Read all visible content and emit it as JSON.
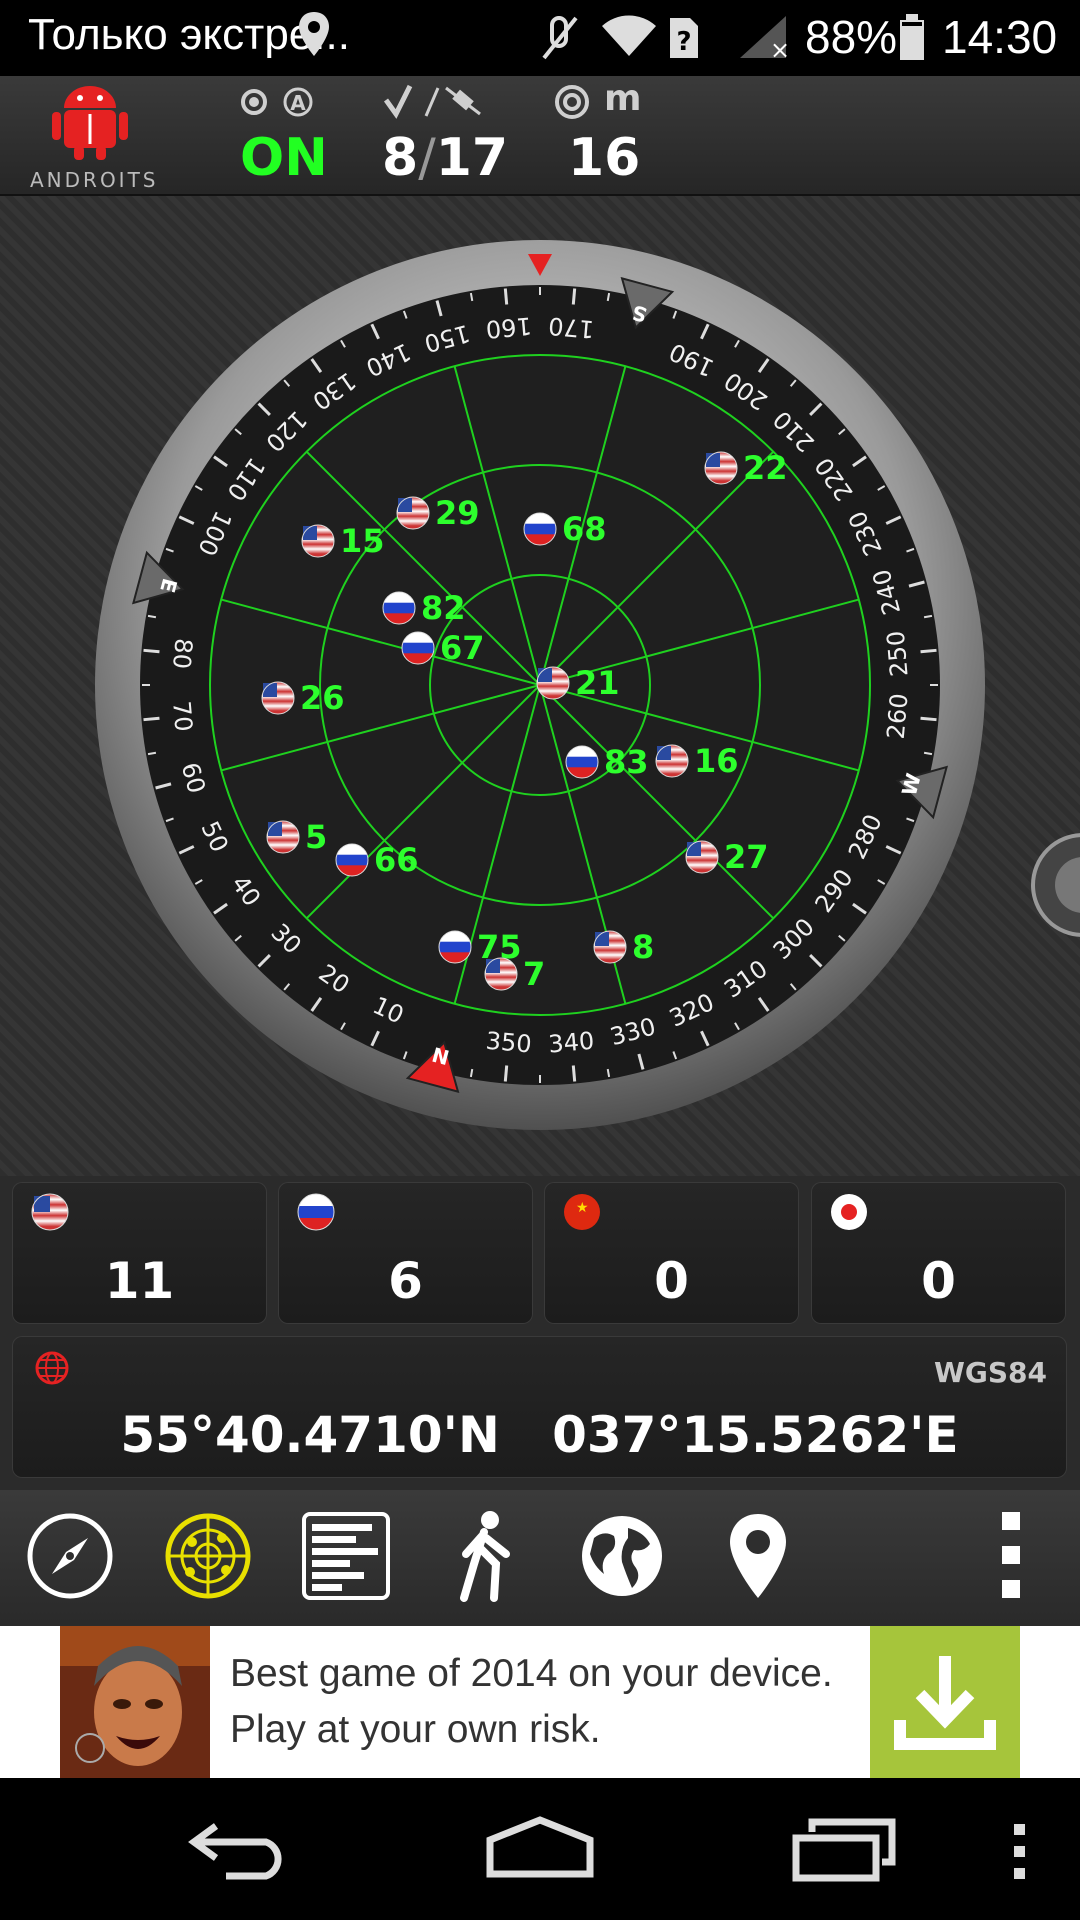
{
  "status_bar": {
    "notification_title": "Только экстре...",
    "battery": "88%",
    "time": "14:30",
    "icons": [
      "location-pin-icon",
      "mute-icon",
      "wifi-icon",
      "sim-unknown-icon",
      "signal-no-sim-icon",
      "battery-icon"
    ]
  },
  "header": {
    "logo_text": "ANDROITS",
    "gps_status": "ON",
    "sats_used": "8",
    "sats_separator": "/",
    "sats_total": "17",
    "accuracy_unit": "m",
    "accuracy_value": "16",
    "colors": {
      "on": "#22ff22",
      "brand": "#e52222"
    }
  },
  "compass": {
    "ticks": [
      "140",
      "150",
      "160",
      "170",
      "190",
      "200",
      "210",
      "220",
      "230",
      "240",
      "250",
      "260",
      "280",
      "290",
      "300",
      "310",
      "320",
      "330",
      "340",
      "350",
      "10",
      "20",
      "30",
      "40",
      "50",
      "60",
      "70",
      "80",
      "100",
      "110",
      "120",
      "130"
    ],
    "cardinals": [
      "N",
      "S",
      "E",
      "W"
    ],
    "satellites": [
      {
        "id": "68",
        "type": "glonass"
      },
      {
        "id": "22",
        "type": "gps"
      },
      {
        "id": "29",
        "type": "gps"
      },
      {
        "id": "15",
        "type": "gps"
      },
      {
        "id": "82",
        "type": "glonass"
      },
      {
        "id": "67",
        "type": "glonass"
      },
      {
        "id": "21",
        "type": "gps"
      },
      {
        "id": "26",
        "type": "gps"
      },
      {
        "id": "83",
        "type": "glonass"
      },
      {
        "id": "16",
        "type": "gps"
      },
      {
        "id": "5",
        "type": "gps"
      },
      {
        "id": "66",
        "type": "glonass"
      },
      {
        "id": "27",
        "type": "gps"
      },
      {
        "id": "75",
        "type": "glonass"
      },
      {
        "id": "7",
        "type": "gps"
      },
      {
        "id": "8",
        "type": "gps"
      }
    ],
    "colors": {
      "grid": "#1fd11f",
      "label": "#2dff2d"
    }
  },
  "constellations": [
    {
      "name": "gps-flag-icon",
      "count": "11"
    },
    {
      "name": "glonass-flag-icon",
      "count": "6"
    },
    {
      "name": "beidou-flag-icon",
      "count": "0"
    },
    {
      "name": "qzss-flag-icon",
      "count": "0"
    }
  ],
  "position": {
    "datum": "WGS84",
    "latitude": "55°40.4710'N",
    "longitude": "037°15.5262'E"
  },
  "toolbar": [
    "compass-icon",
    "radar-icon",
    "signal-bars-icon",
    "walking-icon",
    "globe-icon",
    "map-pin-icon",
    "overflow-menu-icon"
  ],
  "ad": {
    "line1": "Best game of 2014 on your device.",
    "line2": "Play at your own risk.",
    "button_color": "#a6c53b"
  },
  "navbar": [
    "back-icon",
    "home-icon",
    "recent-apps-icon",
    "menu-icon"
  ]
}
